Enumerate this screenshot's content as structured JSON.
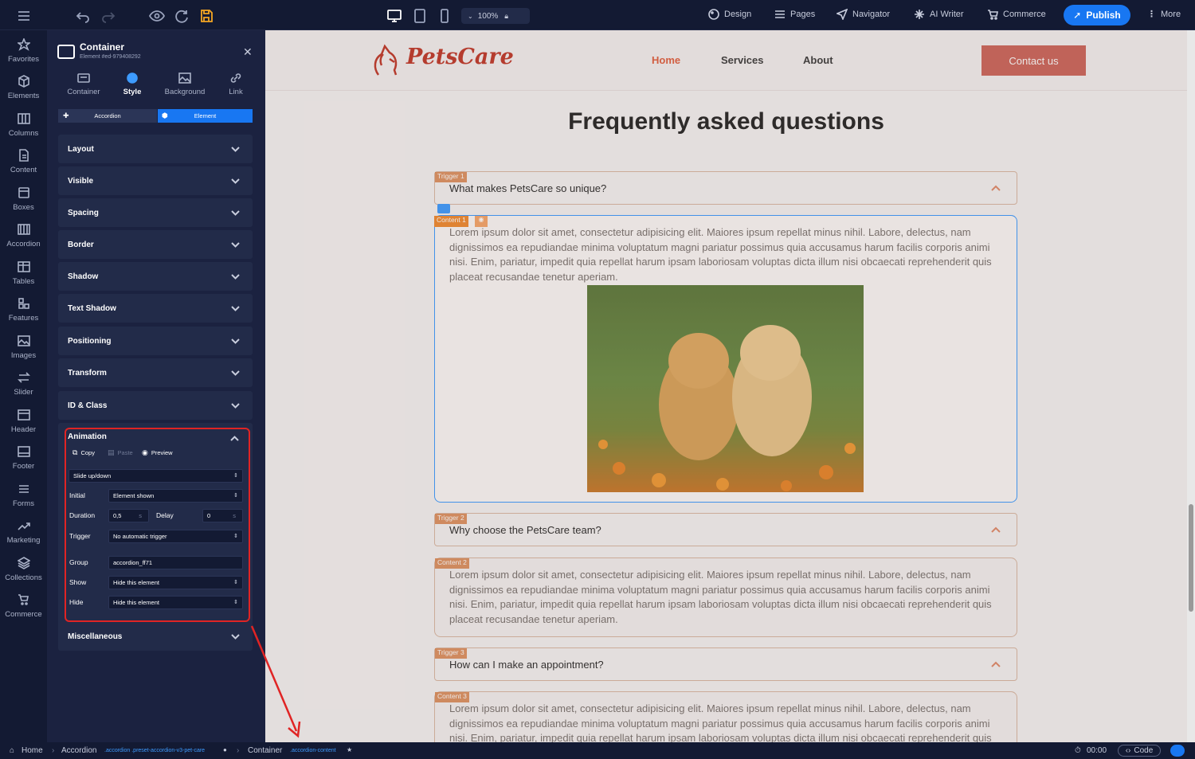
{
  "topbar": {
    "zoom": "100%",
    "nav": [
      {
        "label": "Design",
        "icon": "palette-icon"
      },
      {
        "label": "Pages",
        "icon": "list-icon"
      },
      {
        "label": "Navigator",
        "icon": "navigator-icon"
      },
      {
        "label": "AI Writer",
        "icon": "sparkle-icon"
      },
      {
        "label": "Commerce",
        "icon": "cart-icon"
      }
    ],
    "publish": "Publish",
    "more": "More"
  },
  "rail": [
    "Favorites",
    "Elements",
    "Columns",
    "Content",
    "Boxes",
    "Accordion",
    "Tables",
    "Features",
    "Images",
    "Slider",
    "Header",
    "Footer",
    "Forms",
    "Marketing",
    "Collections",
    "Commerce"
  ],
  "panel": {
    "title": "Container",
    "subtitle": "Element #ed-979408292",
    "tabs": [
      "Container",
      "Style",
      "Background",
      "Link"
    ],
    "active_tab": "Style",
    "segments": [
      "Accordion",
      "Element"
    ],
    "active_segment": "Element",
    "sections": [
      "Layout",
      "Visible",
      "Spacing",
      "Border",
      "Shadow",
      "Text Shadow",
      "Positioning",
      "Transform",
      "ID & Class"
    ],
    "animation": {
      "title": "Animation",
      "copy": "Copy",
      "paste": "Paste",
      "preview": "Preview",
      "effect": "Slide up/down",
      "initial_label": "Initial",
      "initial": "Element shown",
      "duration_label": "Duration",
      "duration": "0,5",
      "duration_unit": "s",
      "delay_label": "Delay",
      "delay": "0",
      "delay_unit": "s",
      "trigger_label": "Trigger",
      "trigger": "No automatic trigger",
      "group_label": "Group",
      "group": "accordion_ff71",
      "show_label": "Show",
      "show": "Hide this element",
      "hide_label": "Hide",
      "hide": "Hide this element"
    },
    "misc": "Miscellaneous"
  },
  "site": {
    "logo": "PetsCare",
    "nav": [
      "Home",
      "Services",
      "About"
    ],
    "cta": "Contact us",
    "heading": "Frequently asked questions",
    "faq": [
      {
        "tag": "Trigger 1",
        "q": "What makes PetsCare so unique?",
        "ctag": "Content 1"
      },
      {
        "tag": "Trigger 2",
        "q": "Why choose the PetsCare team?",
        "ctag": "Content 2"
      },
      {
        "tag": "Trigger 3",
        "q": "How can I make an appointment?",
        "ctag": "Content 3"
      }
    ],
    "lorem": "Lorem ipsum dolor sit amet, consectetur adipisicing elit. Maiores ipsum repellat minus nihil. Labore, delectus, nam dignissimos ea repudiandae minima voluptatum magni pariatur possimus quia accusamus harum facilis corporis animi nisi. Enim, pariatur, impedit quia repellat harum ipsam laboriosam voluptas dicta illum nisi obcaecati reprehenderit quis placeat recusandae tenetur aperiam."
  },
  "status": {
    "home": "Home",
    "accordion": "Accordion",
    "accordion_classes": ".accordion .preset-accordion-v3-pet-care",
    "container": "Container",
    "container_classes": ".accordion-content",
    "time": "00:00",
    "code": "Code"
  },
  "colors": {
    "accent": "#1877f2",
    "highlight": "#e02424",
    "brand": "#c0392b"
  }
}
